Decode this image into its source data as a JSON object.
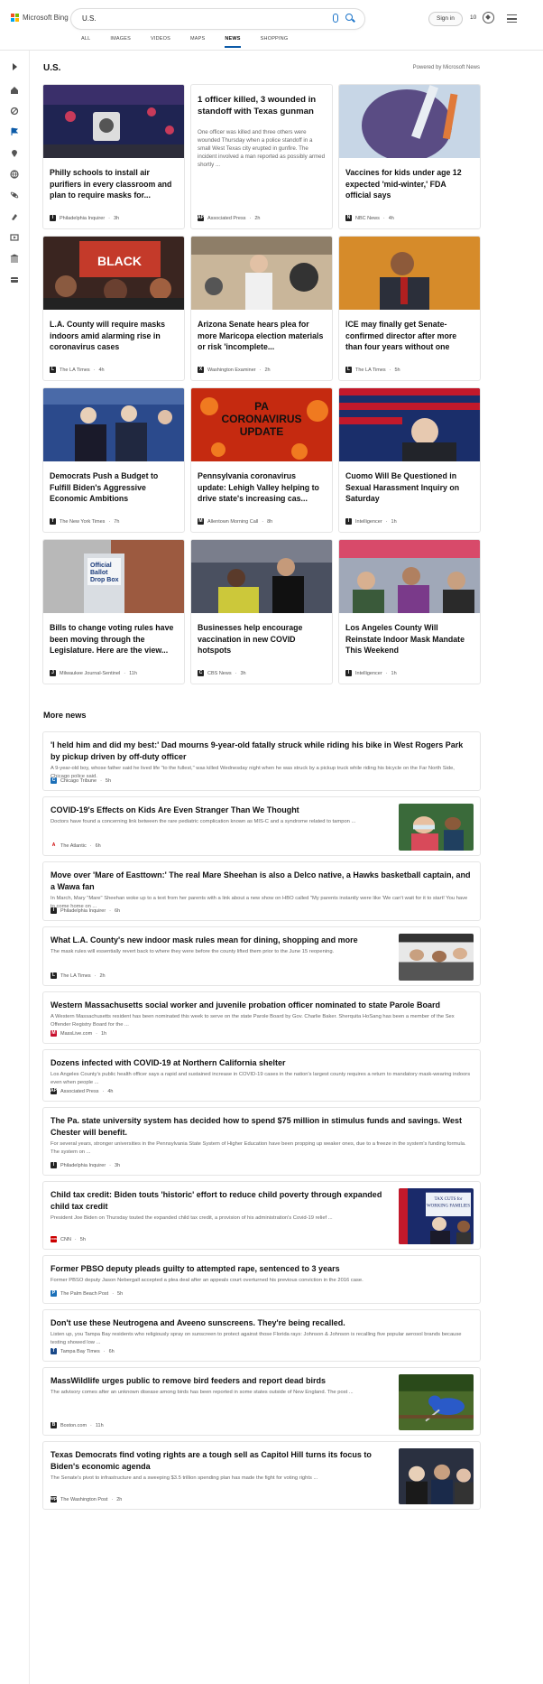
{
  "brand": {
    "name": "Microsoft Bing",
    "colors": [
      "#f25022",
      "#7fba00",
      "#00a4ef",
      "#ffb900"
    ]
  },
  "search": {
    "query": "U.S."
  },
  "account": {
    "signin_label": "Sign in",
    "points": "10"
  },
  "tabs": [
    "ALL",
    "IMAGES",
    "VIDEOS",
    "MAPS",
    "NEWS",
    "SHOPPING"
  ],
  "active_tab": "NEWS",
  "rail_icons": [
    "expand-icon",
    "home-icon",
    "sports-icon",
    "flag-icon",
    "location-icon",
    "world-icon",
    "science-icon",
    "technology-icon",
    "entertainment-icon",
    "politics-icon",
    "business-icon"
  ],
  "section": {
    "title": "U.S.",
    "powered_by": "Powered by Microsoft News"
  },
  "cards": [
    {
      "title": "Philly schools to install air purifiers in every classroom and plan to require masks for...",
      "source": "Philadelphia Inquirer",
      "time": "3h",
      "icon": "I"
    },
    {
      "title": "1 officer killed, 3 wounded in standoff with Texas gunman",
      "body": "One officer was killed and three others were wounded Thursday when a police standoff in a small West Texas city erupted in gunfire. The incident involved a man reported as possibly armed shortly ...",
      "source": "Associated Press",
      "time": "2h",
      "icon": "AP"
    },
    {
      "title": "Vaccines for kids under age 12 expected 'mid-winter,' FDA official says",
      "source": "NBC News",
      "time": "4h",
      "icon": "N"
    },
    {
      "title": "L.A. County will require masks indoors amid alarming rise in coronavirus cases",
      "source": "The LA Times",
      "time": "4h",
      "icon": "L"
    },
    {
      "title": "Arizona Senate hears plea for more Maricopa election materials or risk 'incomplete...",
      "source": "Washington Examiner",
      "time": "2h",
      "icon": "X"
    },
    {
      "title": "ICE may finally get Senate-confirmed director after more than four years without one",
      "source": "The LA Times",
      "time": "5h",
      "icon": "L"
    },
    {
      "title": "Democrats Push a Budget to Fulfill Biden's Aggressive Economic Ambitions",
      "source": "The New York Times",
      "time": "7h",
      "icon": "T"
    },
    {
      "title": "Pennsylvania coronavirus update: Lehigh Valley helping to drive state's increasing cas...",
      "source": "Allentown Morning Call",
      "time": "8h",
      "icon": "M",
      "image_text": [
        "PA",
        "CORONAVIRUS",
        "UPDATE"
      ]
    },
    {
      "title": "Cuomo Will Be Questioned in Sexual Harassment Inquiry on Saturday",
      "source": "Intelligencer",
      "time": "1h",
      "icon": "I"
    },
    {
      "title": "Bills to change voting rules have been moving through the Legislature. Here are the view...",
      "source": "Milwaukee Journal-Sentinel",
      "time": "11h",
      "icon": "J",
      "image_text": [
        "Official",
        "Ballot",
        "Drop Box"
      ]
    },
    {
      "title": "Businesses help encourage vaccination in new COVID hotspots",
      "source": "CBS News",
      "time": "3h",
      "icon": "C"
    },
    {
      "title": "Los Angeles County Will Reinstate Indoor Mask Mandate This Weekend",
      "source": "Intelligencer",
      "time": "1h",
      "icon": "I"
    }
  ],
  "more_news_title": "More news",
  "more_news": [
    {
      "title": "'I held him and did my best:' Dad mourns 9-year-old fatally struck while riding his bike in West Rogers Park by pickup driven by off-duty officer",
      "snippet": "A 9-year-old boy, whose father said he lived life \"to the fullest,\" was killed Wednesday night when he was struck by a pickup truck while riding his bicycle on the Far North Side, Chicago police said.",
      "source": "Chicago Tribune",
      "time": "5h",
      "icon": "C"
    },
    {
      "title": "COVID-19's Effects on Kids Are Even Stranger Than We Thought",
      "snippet": "Doctors have found a concerning link between the rare pediatric complication known as MIS-C and a syndrome related to tampon ...",
      "source": "The Atlantic",
      "time": "6h",
      "icon": "A"
    },
    {
      "title": "Move over 'Mare of Easttown:' The real Mare Sheehan is also a Delco native, a Hawks basketball captain, and a Wawa fan",
      "snippet": "In March, Mary \"Mare\" Sheehan woke up to a text from her parents with a link about a new show on HBO called \"My parents instantly were like 'We can't wait for it to start! You have to come home on ...",
      "source": "Philadelphia Inquirer",
      "time": "6h",
      "icon": "I"
    },
    {
      "title": "What L.A. County's new indoor mask rules mean for dining, shopping and more",
      "snippet": "The mask rules will essentially revert back to where they were before the county lifted them prior to the June 15 reopening.",
      "source": "The LA Times",
      "time": "2h",
      "icon": "L"
    },
    {
      "title": "Western Massachusetts social worker and juvenile probation officer nominated to state Parole Board",
      "snippet": "A Western Massachusetts resident has been nominated this week to serve on the state Parole Board by Gov. Charlie Baker. Sherquita HoSang has been a member of the Sex Offender Registry Board for the ...",
      "source": "MassLive.com",
      "time": "1h",
      "icon": "M"
    },
    {
      "title": "Dozens infected with COVID-19 at Northern California shelter",
      "snippet": "Los Angeles County's public health officer says a rapid and sustained increase in COVID-19 cases in the nation's largest county requires a return to mandatory mask-wearing indoors even when people ...",
      "source": "Associated Press",
      "time": "4h",
      "icon": "AP"
    },
    {
      "title": "The Pa. state university system has decided how to spend $75 million in stimulus funds and savings. West Chester will benefit.",
      "snippet": "For several years, stronger universities in the Pennsylvania State System of Higher Education have been propping up weaker ones, due to a freeze in the system's funding formula. The system on ...",
      "source": "Philadelphia Inquirer",
      "time": "3h",
      "icon": "I"
    },
    {
      "title": "Child tax credit: Biden touts 'historic' effort to reduce child poverty through expanded child tax credit",
      "snippet": "President Joe Biden on Thursday touted the expanded child tax credit, a provision of his administration's Covid-19 relief ...",
      "source": "CNN",
      "time": "5h",
      "icon": "CNN",
      "image_text": [
        "TAX CUTS for",
        "WORKING FAMILIES"
      ]
    },
    {
      "title": "Former PBSO deputy pleads guilty to attempted rape, sentenced to 3 years",
      "snippet": "Former PBSO deputy Jason Nebergall accepted a plea deal after an appeals court overturned his previous conviction in the 2016 case.",
      "source": "The Palm Beach Post",
      "time": "5h",
      "icon": "P"
    },
    {
      "title": "Don't use these Neutrogena and Aveeno sunscreens. They're being recalled.",
      "snippet": "Listen up, you Tampa Bay residents who religiously spray on sunscreen to protect against those Florida rays: Johnson & Johnson is recalling five popular aerosol brands because testing showed low ...",
      "source": "Tampa Bay Times",
      "time": "6h",
      "icon": "T"
    },
    {
      "title": "MassWildlife urges public to remove bird feeders and report dead birds",
      "snippet": "The advisory comes after an unknown disease among birds has been reported in some states outside of New England. The post ...",
      "source": "Boston.com",
      "time": "11h",
      "icon": "B"
    },
    {
      "title": "Texas Democrats find voting rights are a tough sell as Capitol Hill turns its focus to Biden's economic agenda",
      "snippet": "The Senate's pivot to infrastructure and a sweeping $3.5 trillion spending plan has made the fight for voting rights ...",
      "source": "The Washington Post",
      "time": "2h",
      "icon": "wp"
    }
  ]
}
